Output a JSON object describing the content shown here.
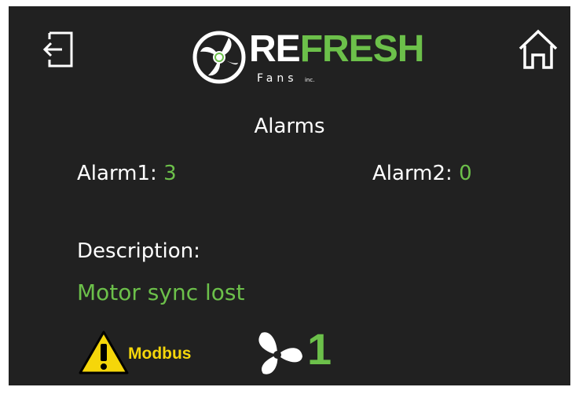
{
  "header": {
    "logo": {
      "word_part1": "RE",
      "word_part2": "FRESH",
      "sub": "Fans",
      "inc": "inc."
    },
    "exit_icon": "exit-icon",
    "home_icon": "home-icon"
  },
  "page_title": "Alarms",
  "alarm1": {
    "label": "Alarm1:",
    "value": "3"
  },
  "alarm2": {
    "label": "Alarm2:",
    "value": "0"
  },
  "description": {
    "label": "Description:",
    "value": "Motor sync lost"
  },
  "status": {
    "warning_icon": "warning-icon",
    "warning_label": "Modbus",
    "fan_icon": "fan-icon",
    "fan_number": "1"
  },
  "colors": {
    "background": "#212121",
    "accent_green": "#6cc04a",
    "text": "#ffffff",
    "warning_yellow": "#f5d60a"
  }
}
